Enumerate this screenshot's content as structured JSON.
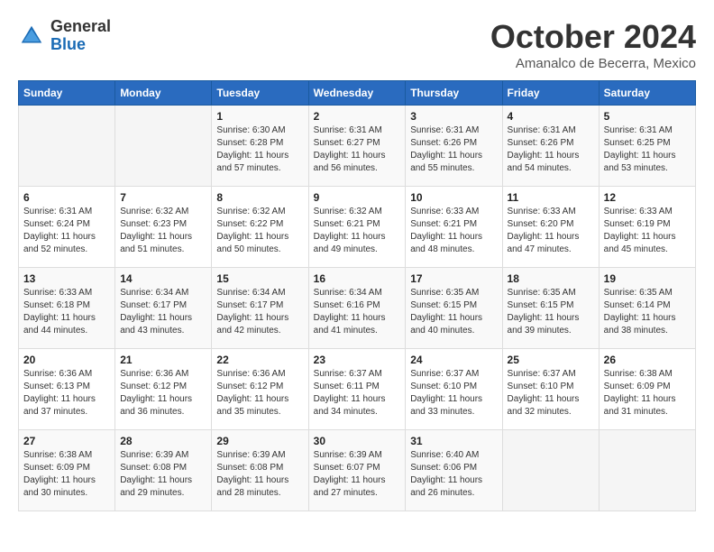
{
  "header": {
    "logo_general": "General",
    "logo_blue": "Blue",
    "month_title": "October 2024",
    "location": "Amanalco de Becerra, Mexico"
  },
  "days_of_week": [
    "Sunday",
    "Monday",
    "Tuesday",
    "Wednesday",
    "Thursday",
    "Friday",
    "Saturday"
  ],
  "weeks": [
    [
      {
        "day": "",
        "info": ""
      },
      {
        "day": "",
        "info": ""
      },
      {
        "day": "1",
        "info": "Sunrise: 6:30 AM\nSunset: 6:28 PM\nDaylight: 11 hours and 57 minutes."
      },
      {
        "day": "2",
        "info": "Sunrise: 6:31 AM\nSunset: 6:27 PM\nDaylight: 11 hours and 56 minutes."
      },
      {
        "day": "3",
        "info": "Sunrise: 6:31 AM\nSunset: 6:26 PM\nDaylight: 11 hours and 55 minutes."
      },
      {
        "day": "4",
        "info": "Sunrise: 6:31 AM\nSunset: 6:26 PM\nDaylight: 11 hours and 54 minutes."
      },
      {
        "day": "5",
        "info": "Sunrise: 6:31 AM\nSunset: 6:25 PM\nDaylight: 11 hours and 53 minutes."
      }
    ],
    [
      {
        "day": "6",
        "info": "Sunrise: 6:31 AM\nSunset: 6:24 PM\nDaylight: 11 hours and 52 minutes."
      },
      {
        "day": "7",
        "info": "Sunrise: 6:32 AM\nSunset: 6:23 PM\nDaylight: 11 hours and 51 minutes."
      },
      {
        "day": "8",
        "info": "Sunrise: 6:32 AM\nSunset: 6:22 PM\nDaylight: 11 hours and 50 minutes."
      },
      {
        "day": "9",
        "info": "Sunrise: 6:32 AM\nSunset: 6:21 PM\nDaylight: 11 hours and 49 minutes."
      },
      {
        "day": "10",
        "info": "Sunrise: 6:33 AM\nSunset: 6:21 PM\nDaylight: 11 hours and 48 minutes."
      },
      {
        "day": "11",
        "info": "Sunrise: 6:33 AM\nSunset: 6:20 PM\nDaylight: 11 hours and 47 minutes."
      },
      {
        "day": "12",
        "info": "Sunrise: 6:33 AM\nSunset: 6:19 PM\nDaylight: 11 hours and 45 minutes."
      }
    ],
    [
      {
        "day": "13",
        "info": "Sunrise: 6:33 AM\nSunset: 6:18 PM\nDaylight: 11 hours and 44 minutes."
      },
      {
        "day": "14",
        "info": "Sunrise: 6:34 AM\nSunset: 6:17 PM\nDaylight: 11 hours and 43 minutes."
      },
      {
        "day": "15",
        "info": "Sunrise: 6:34 AM\nSunset: 6:17 PM\nDaylight: 11 hours and 42 minutes."
      },
      {
        "day": "16",
        "info": "Sunrise: 6:34 AM\nSunset: 6:16 PM\nDaylight: 11 hours and 41 minutes."
      },
      {
        "day": "17",
        "info": "Sunrise: 6:35 AM\nSunset: 6:15 PM\nDaylight: 11 hours and 40 minutes."
      },
      {
        "day": "18",
        "info": "Sunrise: 6:35 AM\nSunset: 6:15 PM\nDaylight: 11 hours and 39 minutes."
      },
      {
        "day": "19",
        "info": "Sunrise: 6:35 AM\nSunset: 6:14 PM\nDaylight: 11 hours and 38 minutes."
      }
    ],
    [
      {
        "day": "20",
        "info": "Sunrise: 6:36 AM\nSunset: 6:13 PM\nDaylight: 11 hours and 37 minutes."
      },
      {
        "day": "21",
        "info": "Sunrise: 6:36 AM\nSunset: 6:12 PM\nDaylight: 11 hours and 36 minutes."
      },
      {
        "day": "22",
        "info": "Sunrise: 6:36 AM\nSunset: 6:12 PM\nDaylight: 11 hours and 35 minutes."
      },
      {
        "day": "23",
        "info": "Sunrise: 6:37 AM\nSunset: 6:11 PM\nDaylight: 11 hours and 34 minutes."
      },
      {
        "day": "24",
        "info": "Sunrise: 6:37 AM\nSunset: 6:10 PM\nDaylight: 11 hours and 33 minutes."
      },
      {
        "day": "25",
        "info": "Sunrise: 6:37 AM\nSunset: 6:10 PM\nDaylight: 11 hours and 32 minutes."
      },
      {
        "day": "26",
        "info": "Sunrise: 6:38 AM\nSunset: 6:09 PM\nDaylight: 11 hours and 31 minutes."
      }
    ],
    [
      {
        "day": "27",
        "info": "Sunrise: 6:38 AM\nSunset: 6:09 PM\nDaylight: 11 hours and 30 minutes."
      },
      {
        "day": "28",
        "info": "Sunrise: 6:39 AM\nSunset: 6:08 PM\nDaylight: 11 hours and 29 minutes."
      },
      {
        "day": "29",
        "info": "Sunrise: 6:39 AM\nSunset: 6:08 PM\nDaylight: 11 hours and 28 minutes."
      },
      {
        "day": "30",
        "info": "Sunrise: 6:39 AM\nSunset: 6:07 PM\nDaylight: 11 hours and 27 minutes."
      },
      {
        "day": "31",
        "info": "Sunrise: 6:40 AM\nSunset: 6:06 PM\nDaylight: 11 hours and 26 minutes."
      },
      {
        "day": "",
        "info": ""
      },
      {
        "day": "",
        "info": ""
      }
    ]
  ]
}
